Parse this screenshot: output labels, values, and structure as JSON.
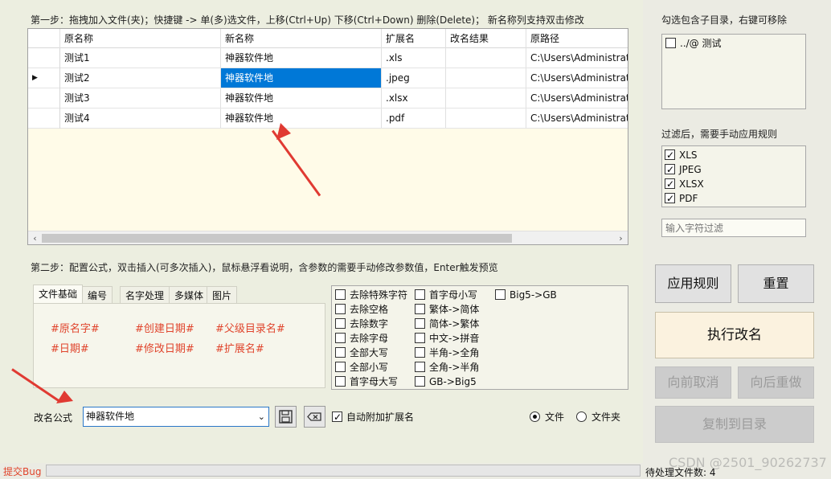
{
  "step1_label": "第一步：拖拽加入文件(夹)；快捷键 -> 单(多)选文件，上移(Ctrl+Up) 下移(Ctrl+Down) 删除(Delete)；  新名称列支持双击修改",
  "table": {
    "headers": [
      "原名称",
      "新名称",
      "扩展名",
      "改名结果",
      "原路径"
    ],
    "rows": [
      {
        "orig": "测试1",
        "new": "神器软件地",
        "ext": ".xls",
        "result": "",
        "path": "C:\\Users\\Administrato"
      },
      {
        "orig": "测试2",
        "new": "神器软件地",
        "ext": ".jpeg",
        "result": "",
        "path": "C:\\Users\\Administrato"
      },
      {
        "orig": "测试3",
        "new": "神器软件地",
        "ext": ".xlsx",
        "result": "",
        "path": "C:\\Users\\Administrato"
      },
      {
        "orig": "测试4",
        "new": "神器软件地",
        "ext": ".pdf",
        "result": "",
        "path": "C:\\Users\\Administrato"
      }
    ],
    "current_row_marker": "▶"
  },
  "step2_label": "第二步：配置公式，双击插入(可多次插入)，鼠标悬浮看说明，含参数的需要手动修改参数值，Enter触发预览",
  "tabs": [
    "文件基础",
    "编号",
    "名字处理",
    "多媒体",
    "图片"
  ],
  "formulas": [
    "#原名字#",
    "#创建日期#",
    "#父级目录名#",
    "#日期#",
    "#修改日期#",
    "#扩展名#"
  ],
  "options": {
    "col1": [
      "去除特殊字符",
      "去除空格",
      "去除数字",
      "去除字母",
      "全部大写",
      "全部小写",
      "首字母大写"
    ],
    "col2": [
      "首字母小写",
      "繁体->简体",
      "简体->繁体",
      "中文->拼音",
      "半角->全角",
      "全角->半角",
      "GB->Big5"
    ],
    "col3": [
      "Big5->GB"
    ]
  },
  "formula_label": "改名公式",
  "formula_value": "神器软件地",
  "auto_ext_label": "自动附加扩展名",
  "radio_file": "文件",
  "radio_folder": "文件夹",
  "right": {
    "subdir_label": "勾选包含子目录，右键可移除",
    "subdir_item": "../@ 测试",
    "filter_label": "过滤后，需要手动应用规则",
    "filters": [
      "XLS",
      "JPEG",
      "XLSX",
      "PDF"
    ],
    "filter_placeholder": "输入字符过滤",
    "apply": "应用规则",
    "reset": "重置",
    "execute": "执行改名",
    "undo": "向前取消",
    "redo": "向后重做",
    "copy": "复制到目录"
  },
  "status": {
    "bug": "提交Bug",
    "pending": "待处理文件数: 4",
    "watermark": "CSDN @2501_90262737"
  },
  "colors": {
    "accent": "#0078d7",
    "formula": "#e0442c",
    "arrow": "#e03a32"
  }
}
